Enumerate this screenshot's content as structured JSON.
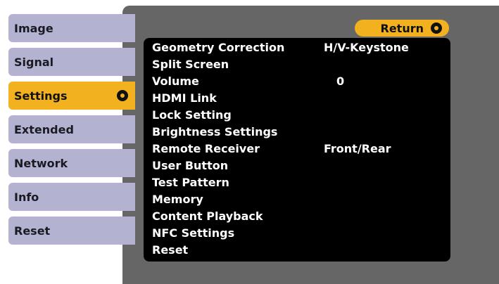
{
  "sidebar": {
    "tabs": [
      {
        "label": "Image"
      },
      {
        "label": "Signal"
      },
      {
        "label": "Settings",
        "active": true
      },
      {
        "label": "Extended"
      },
      {
        "label": "Network"
      },
      {
        "label": "Info"
      },
      {
        "label": "Reset"
      }
    ]
  },
  "return_button": {
    "label": "Return"
  },
  "menu": {
    "items": [
      {
        "label": "Geometry Correction",
        "value": "H/V-Keystone"
      },
      {
        "label": "Split Screen",
        "value": ""
      },
      {
        "label": "Volume",
        "value": "0"
      },
      {
        "label": "HDMI Link",
        "value": ""
      },
      {
        "label": "Lock Setting",
        "value": ""
      },
      {
        "label": "Brightness Settings",
        "value": ""
      },
      {
        "label": "Remote Receiver",
        "value": "Front/Rear"
      },
      {
        "label": "User Button",
        "value": ""
      },
      {
        "label": "Test Pattern",
        "value": ""
      },
      {
        "label": "Memory",
        "value": ""
      },
      {
        "label": "Content Playback",
        "value": ""
      },
      {
        "label": "NFC Settings",
        "value": ""
      },
      {
        "label": "Reset",
        "value": ""
      }
    ]
  },
  "colors": {
    "accent": "#f2b11f",
    "tab_bg": "#b3b3d1",
    "panel_bg": "#666666",
    "menu_bg": "#000000"
  },
  "icons": {
    "active_tab": "enter-icon",
    "return": "enter-icon"
  }
}
